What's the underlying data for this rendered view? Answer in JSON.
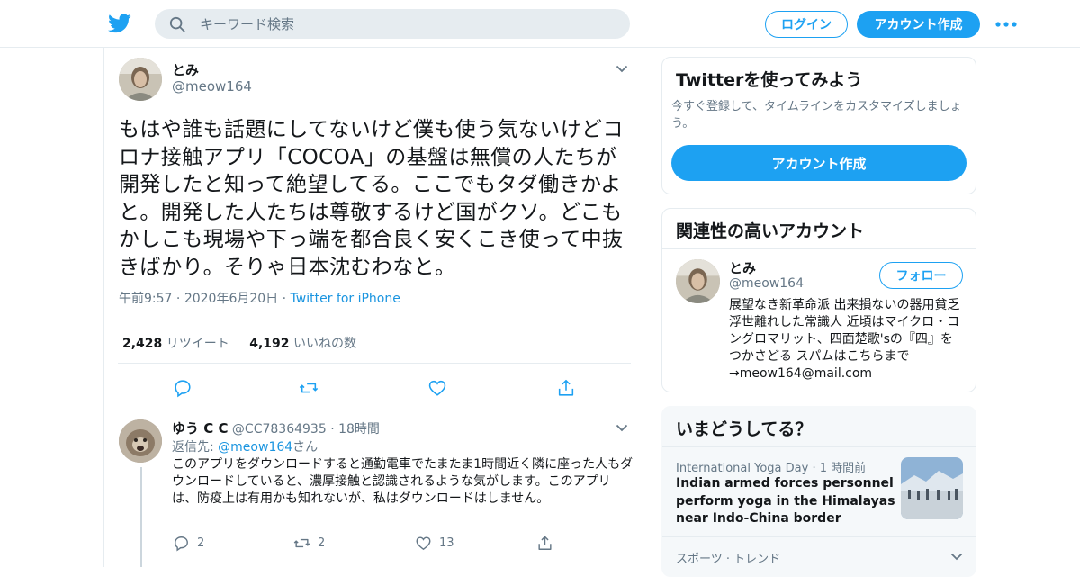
{
  "header": {
    "search_placeholder": "キーワード検索",
    "login_label": "ログイン",
    "signup_label": "アカウント作成"
  },
  "tweet": {
    "display_name": "とみ",
    "handle": "@meow164",
    "text": "もはや誰も話題にしてないけど僕も使う気ないけどコロナ接触アプリ「COCOA」の基盤は無償の人たちが開発したと知って絶望してる。ここでもタダ働きかよと。開発した人たちは尊敬するけど国がクソ。どこもかしこも現場や下っ端を都合良く安くこき使って中抜きばかり。そりゃ日本沈むわなと。",
    "time": "午前9:57",
    "date": "2020年6月20日",
    "source": "Twitter for iPhone",
    "retweet_count": "2,428",
    "retweet_label": "リツイート",
    "like_count": "4,192",
    "like_label": "いいねの数"
  },
  "reply": {
    "display_name": "ゆう C C",
    "handle": "@CC78364935",
    "time_ago": "18時間",
    "reply_to_label": "返信先:",
    "reply_to_handle": "@meow164",
    "reply_to_suffix": "さん",
    "text": "このアプリをダウンロードすると通勤電車でたまたま1時間近く隣に座った人もダウンロードしていると、濃厚接触と認識されるような気がします。このアプリは、防疫上は有用かも知れないが、私はダウンロードはしません。",
    "reply_count": "2",
    "retweet_count": "2",
    "like_count": "13"
  },
  "sidebar": {
    "signup_card": {
      "title": "Twitterを使ってみよう",
      "subtitle": "今すぐ登録して、タイムラインをカスタマイズしましょう。",
      "button_label": "アカウント作成"
    },
    "related_card": {
      "title": "関連性の高いアカウント",
      "account": {
        "display_name": "とみ",
        "handle": "@meow164",
        "follow_label": "フォロー",
        "bio": "展望なき新革命派 出来損ないの器用貧乏 浮世離れした常識人 近頃はマイクロ・コングロマリット、四面楚歌'sの『四』をつかさどる スパムはこちらまで→meow164@mail.com"
      }
    },
    "trends_card": {
      "title": "いまどうしてる？",
      "item": {
        "category": "International Yoga Day",
        "time_ago": "1 時間前",
        "title": "Indian armed forces personnel perform yoga in the Himalayas near Indo-China border"
      },
      "next_label": "スポーツ · トレンド"
    }
  }
}
